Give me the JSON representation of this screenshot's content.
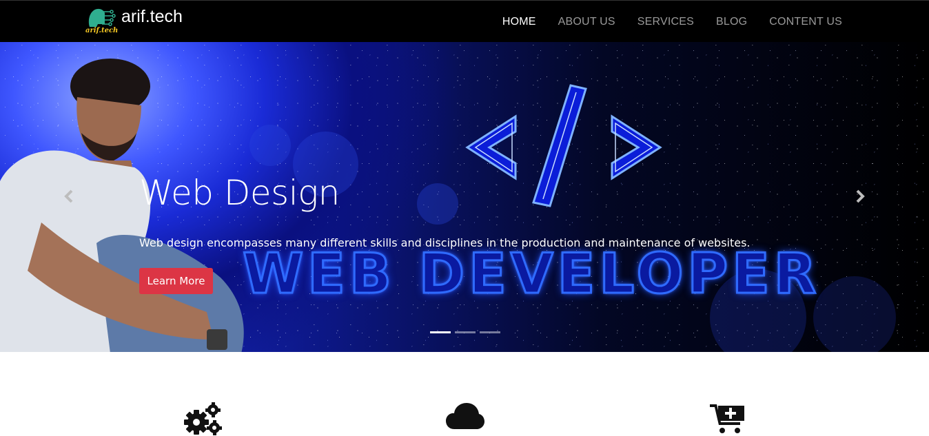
{
  "brand": {
    "name": "arif.tech",
    "logo_text": "arif.tech"
  },
  "nav": [
    {
      "label": "HOME",
      "active": true
    },
    {
      "label": "ABOUT US",
      "active": false
    },
    {
      "label": "SERVICES",
      "active": false
    },
    {
      "label": "BLOG",
      "active": false
    },
    {
      "label": "CONTENT US",
      "active": false
    }
  ],
  "hero": {
    "title": "Web Design",
    "description": "Web design encompasses many different skills and disciplines in the production and maintenance of websites.",
    "button_label": "Learn More",
    "banner_text": "WEB DEVELOPER",
    "slide_count": 3,
    "active_slide": 1,
    "prev_icon": "chevron-left-icon",
    "next_icon": "chevron-right-icon"
  },
  "features": [
    {
      "icon": "gears-icon"
    },
    {
      "icon": "cloud-icon"
    },
    {
      "icon": "cart-plus-icon"
    }
  ],
  "colors": {
    "accent": "#dc3545",
    "nav_bg": "#000000",
    "hero_blue": "#1e2fe0"
  }
}
